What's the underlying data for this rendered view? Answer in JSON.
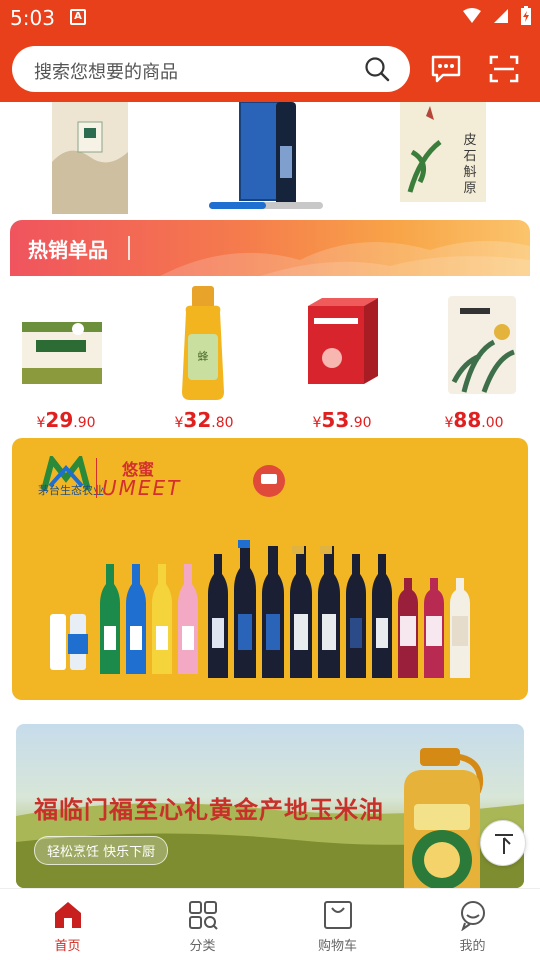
{
  "status": {
    "time": "5:03",
    "notif": "A"
  },
  "search": {
    "placeholder": "搜索您想要的商品"
  },
  "icons": {
    "search": "search-icon",
    "message": "message-icon",
    "scan": "scan-icon"
  },
  "hot": {
    "title": "热销单品"
  },
  "products": [
    {
      "currency": "¥",
      "int": "29",
      "dec": ".90"
    },
    {
      "currency": "¥",
      "int": "32",
      "dec": ".80"
    },
    {
      "currency": "¥",
      "int": "53",
      "dec": ".90"
    },
    {
      "currency": "¥",
      "int": "88",
      "dec": ".00"
    }
  ],
  "umeet": {
    "brand_cn": "悠蜜",
    "brand_en": "UMEET",
    "company": "茅台生态农业"
  },
  "oil": {
    "title": "福临门福至心礼黄金产地玉米油",
    "subtitle": "轻松烹饪 快乐下厨"
  },
  "tabs": [
    {
      "label": "首页",
      "icon": "home-icon",
      "active": true
    },
    {
      "label": "分类",
      "icon": "category-icon",
      "active": false
    },
    {
      "label": "购物车",
      "icon": "cart-icon",
      "active": false
    },
    {
      "label": "我的",
      "icon": "profile-icon",
      "active": false
    }
  ],
  "colors": {
    "brand": "#e8401a",
    "price": "#e02020",
    "active_tab": "#d02b22",
    "indicator": "#1f6fd0"
  },
  "banner_progress": 0.5
}
